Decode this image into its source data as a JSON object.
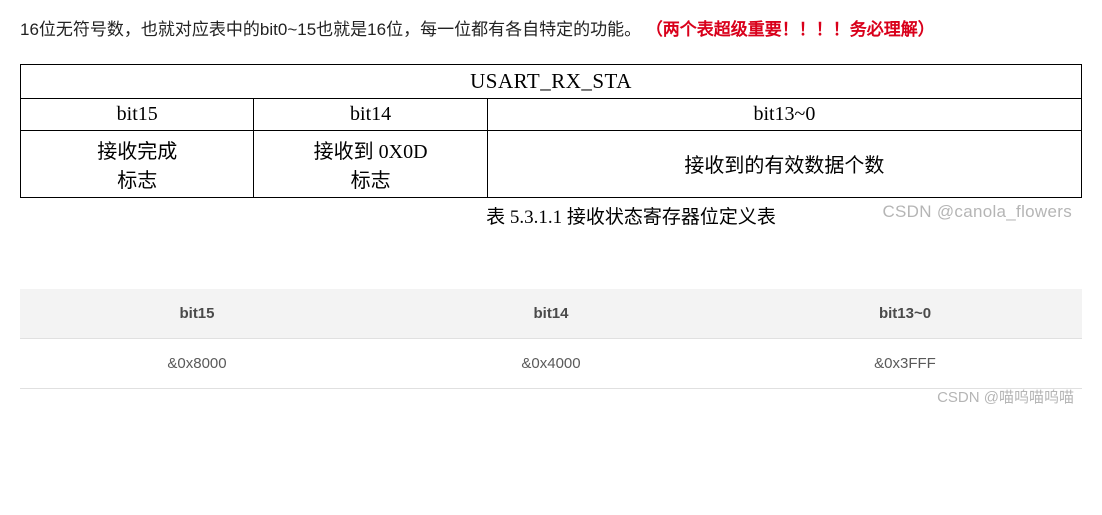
{
  "intro": {
    "text_part1": "16位无符号数，也就对应表中的bit0~15也就是16位，每一位都有各自特定的功能。 ",
    "emphasis": "（两个表超级重要！！！！务必理解）"
  },
  "table1": {
    "title": "USART_RX_STA",
    "headers": [
      "bit15",
      "bit14",
      "bit13~0"
    ],
    "row_descriptions": {
      "c1_line1": "接收完成",
      "c1_line2": "标志",
      "c2_line1": "接收到 0X0D",
      "c2_line2": "标志",
      "c3": "接收到的有效数据个数"
    }
  },
  "caption": "表 5.3.1.1  接收状态寄存器位定义表",
  "watermark1": "CSDN @canola_flowers",
  "table2": {
    "headers": [
      "bit15",
      "bit14",
      "bit13~0"
    ],
    "values": [
      "&0x8000",
      "&0x4000",
      "&0x3FFF"
    ]
  },
  "watermark2": "CSDN @喵呜喵呜喵"
}
